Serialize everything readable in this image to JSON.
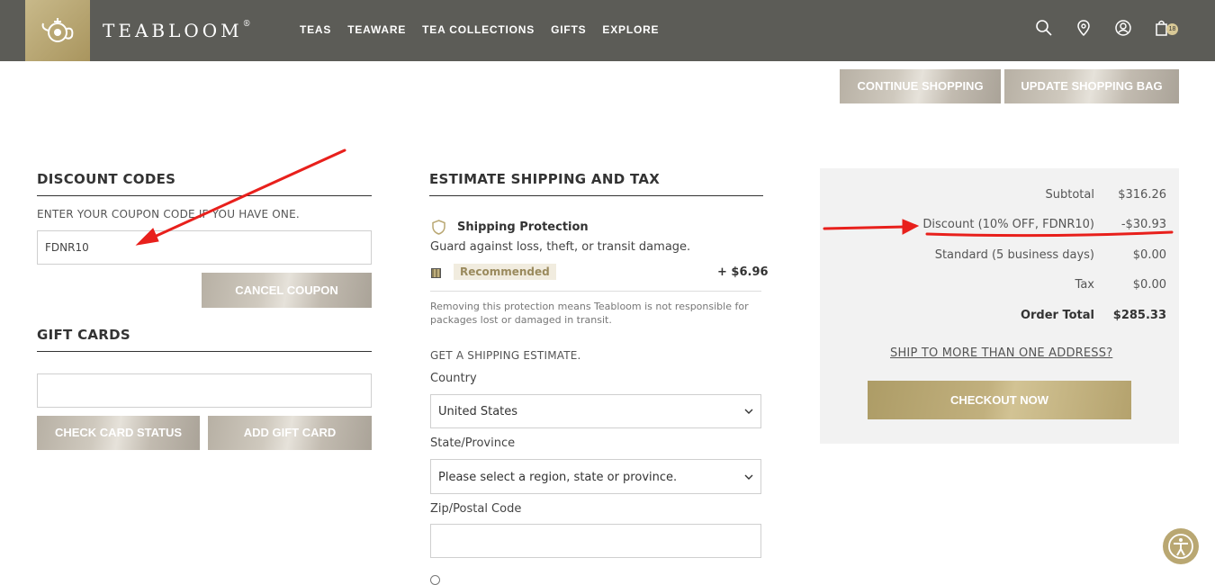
{
  "header": {
    "brand": "TEABLOOM",
    "trademark": "®",
    "nav": [
      "TEAS",
      "TEAWARE",
      "TEA COLLECTIONS",
      "GIFTS",
      "EXPLORE"
    ],
    "bag_count": "18"
  },
  "actions": {
    "continue_shopping": "CONTINUE SHOPPING",
    "update_bag": "UPDATE SHOPPING BAG"
  },
  "discount": {
    "title": "DISCOUNT CODES",
    "instruction": "ENTER YOUR COUPON CODE IF YOU HAVE ONE.",
    "code_value": "FDNR10",
    "cancel_label": "CANCEL COUPON"
  },
  "gift_cards": {
    "title": "GIFT CARDS",
    "check_label": "CHECK CARD STATUS",
    "add_label": "ADD GIFT CARD"
  },
  "shipping": {
    "title": "ESTIMATE SHIPPING AND TAX",
    "protection_title": "Shipping Protection",
    "protection_desc": "Guard against loss, theft, or transit damage.",
    "recommended": "Recommended",
    "protection_price": "+ $6.96",
    "protection_note_1": "Removing this protection means Teabloom is not responsible for",
    "protection_note_2": "packages lost or damaged in transit.",
    "estimate_label": "GET A SHIPPING ESTIMATE.",
    "country_label": "Country",
    "country_value": "United States",
    "state_label": "State/Province",
    "state_value": "Please select a region, state or province.",
    "zip_label": "Zip/Postal Code"
  },
  "summary": {
    "rows": [
      {
        "label": "Subtotal",
        "value": "$316.26"
      },
      {
        "label": "Discount (10% OFF, FDNR10)",
        "value": "-$30.93"
      },
      {
        "label": "Standard (5 business days)",
        "value": "$0.00"
      },
      {
        "label": "Tax",
        "value": "$0.00"
      }
    ],
    "total_label": "Order Total",
    "total_value": "$285.33",
    "multi_address": "SHIP TO MORE THAN ONE ADDRESS?",
    "checkout": "CHECKOUT NOW"
  },
  "colors": {
    "header_bg": "#5c5c57",
    "gold": "#b9a772",
    "annotation_red": "#e8201c"
  }
}
